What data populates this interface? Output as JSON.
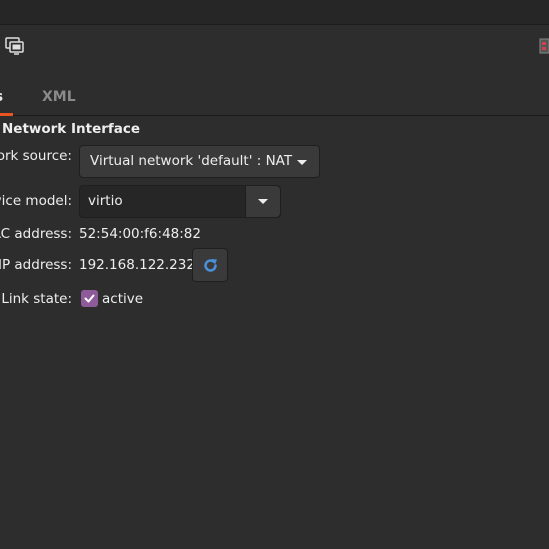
{
  "window": {
    "toolbar_icons": [
      "console-display-icon",
      "window-edge-icon"
    ]
  },
  "tabs": [
    {
      "label": "ls",
      "active": true
    },
    {
      "label": "XML",
      "active": false
    }
  ],
  "section": {
    "title": "Network Interface"
  },
  "fields": {
    "network_source": {
      "label": "ork source:",
      "value": "Virtual network 'default' : NAT"
    },
    "device_model": {
      "label": "vice model:",
      "value": "virtio"
    },
    "mac_address": {
      "label": "AC address:",
      "value": "52:54:00:f6:48:82"
    },
    "ip_address": {
      "label": "IP address:",
      "value": "192.168.122.232"
    },
    "link_state": {
      "label": "Link state:",
      "checked": true,
      "checkbox_label": "active"
    }
  },
  "colors": {
    "background": "#2d2d2d",
    "tab_accent": "#e95420",
    "checkbox": "#8e5b9a",
    "refresh_icon": "#4a90d9"
  }
}
